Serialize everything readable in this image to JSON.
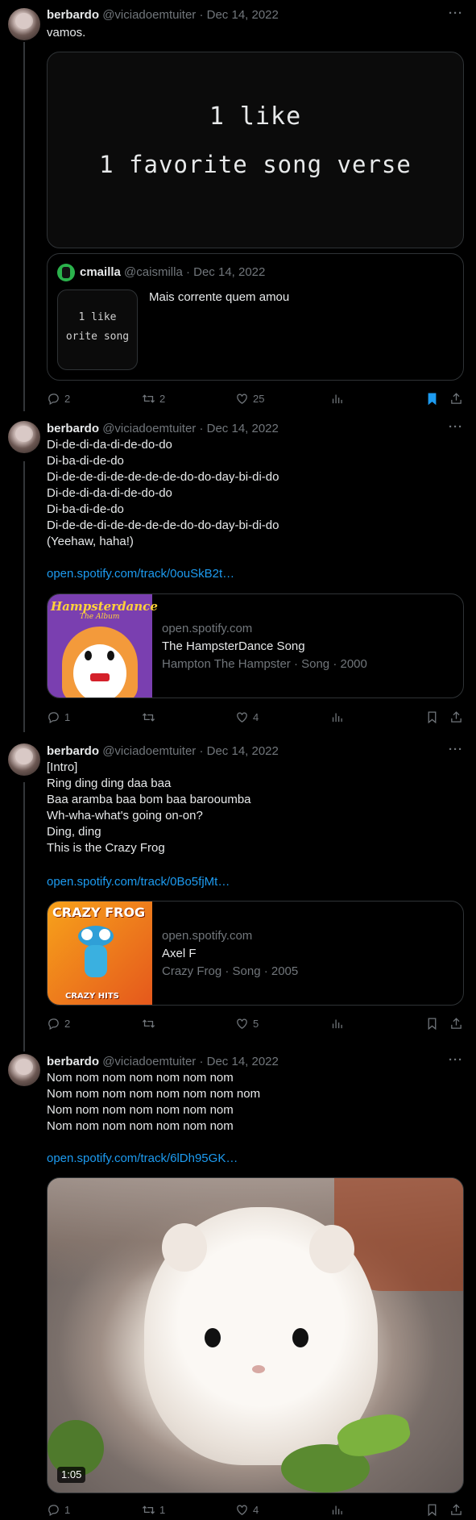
{
  "tweets": [
    {
      "name": "berbardo",
      "handle": "@viciadoemtuiter",
      "date": "· Dec 14, 2022",
      "text": "vamos.",
      "media_line1": "1 like",
      "media_line2": "1 favorite song verse",
      "quote": {
        "name": "cmailla",
        "handle": "@caismilla",
        "date": "· Dec 14, 2022",
        "thumb_line1": "1 like",
        "thumb_line2": "orite song",
        "text": "Mais corrente quem amou"
      },
      "replies": "2",
      "retweets": "2",
      "likes": "25"
    },
    {
      "name": "berbardo",
      "handle": "@viciadoemtuiter",
      "date": "· Dec 14, 2022",
      "lines": [
        "Di-de-di-da-di-de-do-do",
        "Di-ba-di-de-do",
        "Di-de-de-di-de-de-de-de-do-do-day-bi-di-do",
        "Di-de-di-da-di-de-do-do",
        "Di-ba-di-de-do",
        "Di-de-de-di-de-de-de-de-do-do-day-bi-di-do",
        "(Yeehaw, haha!)"
      ],
      "link": "open.spotify.com/track/0ouSkB2t…",
      "card": {
        "thumb_title": "Hampsterdance",
        "thumb_subtitle": "The Album",
        "domain": "open.spotify.com",
        "title": "The HampsterDance Song",
        "sub": "Hampton The Hampster · Song · 2000"
      },
      "replies": "1",
      "retweets": "",
      "likes": "4"
    },
    {
      "name": "berbardo",
      "handle": "@viciadoemtuiter",
      "date": "· Dec 14, 2022",
      "lines": [
        "[Intro]",
        "Ring ding ding daa baa",
        "Baa aramba baa bom baa barooumba",
        "Wh-wha-what's going on-on?",
        "Ding, ding",
        "This is the Crazy Frog"
      ],
      "link": "open.spotify.com/track/0Bo5fjMt…",
      "card": {
        "thumb_title": "CRAZY FROG",
        "thumb_subtitle": "CRAZY HITS",
        "domain": "open.spotify.com",
        "title": "Axel F",
        "sub": "Crazy Frog · Song · 2005"
      },
      "replies": "2",
      "retweets": "",
      "likes": "5"
    },
    {
      "name": "berbardo",
      "handle": "@viciadoemtuiter",
      "date": "· Dec 14, 2022",
      "lines": [
        "Nom nom nom nom nom nom nom",
        "Nom nom nom nom nom nom nom nom",
        "Nom nom nom nom nom nom nom",
        "Nom nom nom nom nom nom nom"
      ],
      "link": "open.spotify.com/track/6lDh95GK…",
      "video_duration": "1:05",
      "replies": "1",
      "retweets": "1",
      "likes": "4"
    }
  ],
  "colors": {
    "accent": "#1d9bf0",
    "muted": "#71767b",
    "border": "#2f3336",
    "bookmark_active": "#1d9bf0"
  },
  "icons": [
    "reply-icon",
    "retweet-icon",
    "like-icon",
    "views-icon",
    "bookmark-icon",
    "share-icon",
    "more-icon"
  ]
}
